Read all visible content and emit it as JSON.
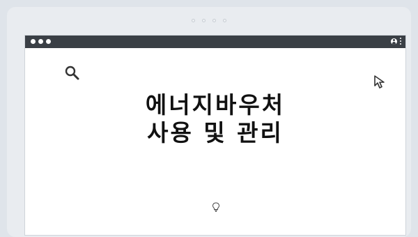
{
  "window": {
    "title_line1": "에너지바우처",
    "title_line2": "사용 및 관리"
  },
  "icons": {
    "search": "search-icon",
    "cursor": "cursor-arrow-icon",
    "bulb": "lightbulb-icon",
    "profile": "profile-icon",
    "menu": "kebab-menu-icon"
  },
  "colors": {
    "titlebar": "#3a3f45",
    "page_bg": "#dfe4ea",
    "window_bg": "#ffffff",
    "text": "#111111"
  }
}
